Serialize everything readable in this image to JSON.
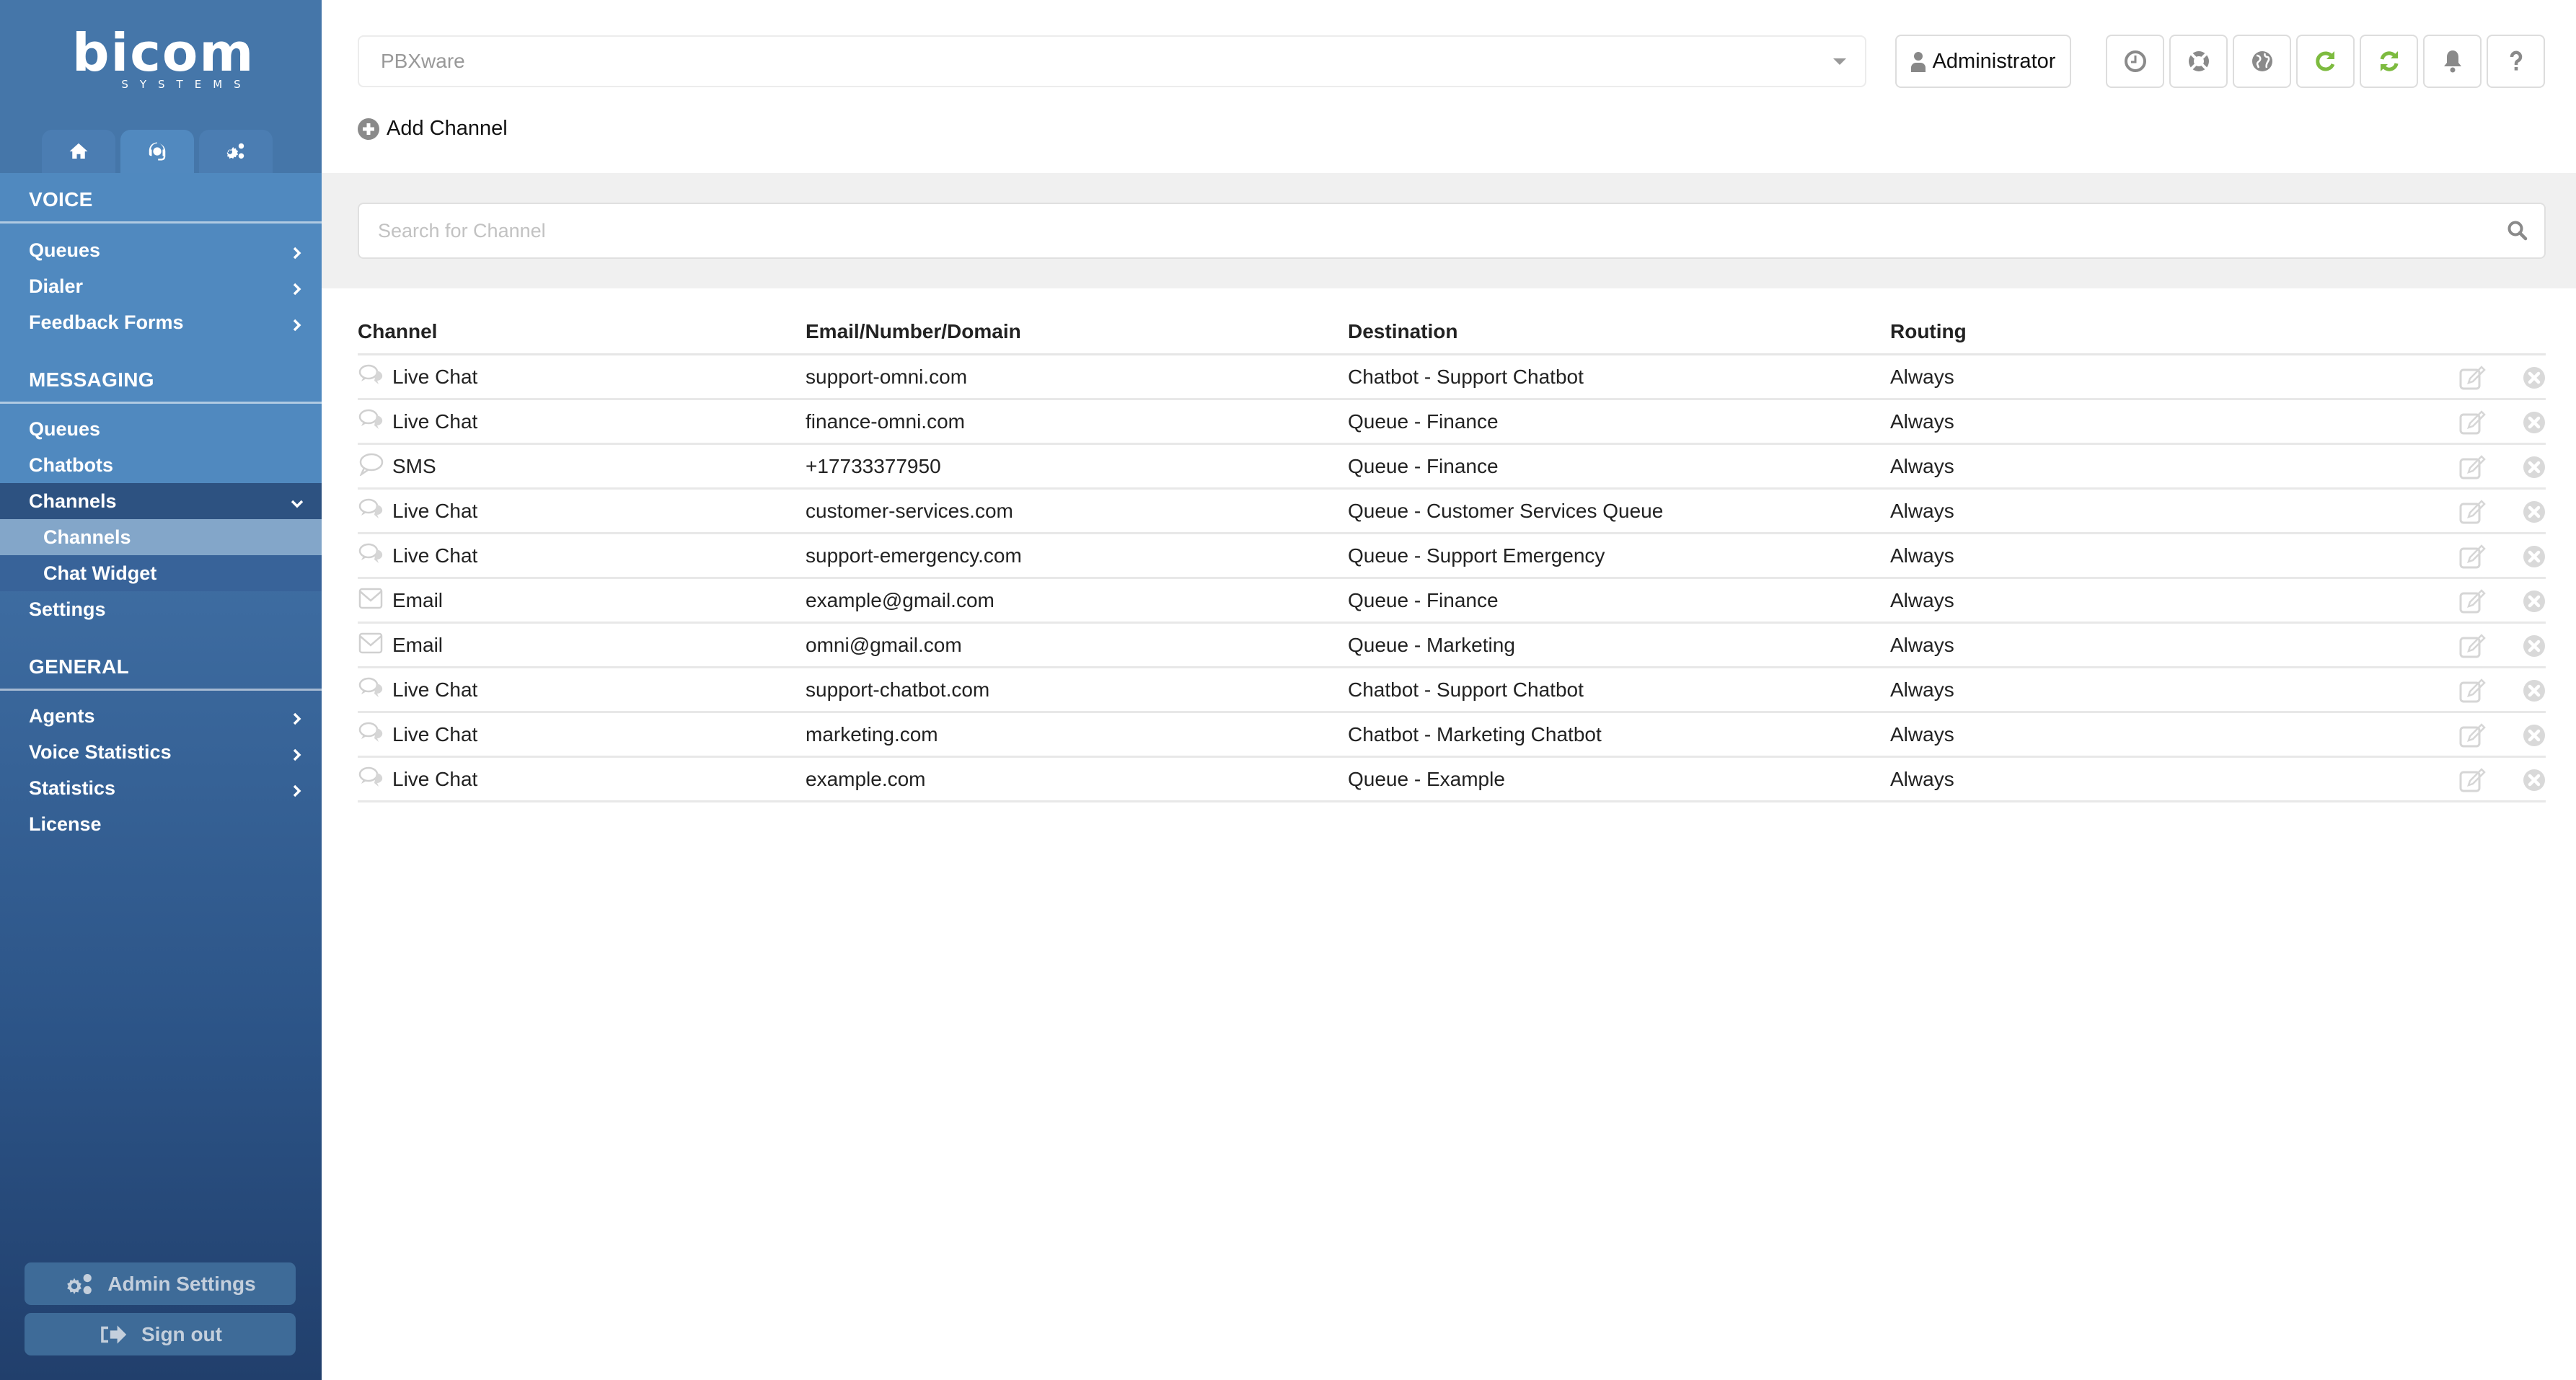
{
  "brand": {
    "name": "bicom",
    "tagline": "SYSTEMS"
  },
  "top_tabs": [
    {
      "name": "home",
      "icon": "home-icon",
      "active": false
    },
    {
      "name": "omni-agent",
      "icon": "headset-icon",
      "active": true
    },
    {
      "name": "settings",
      "icon": "gears-icon",
      "active": false
    }
  ],
  "sidebar": {
    "sections": [
      {
        "title": "VOICE",
        "items": [
          {
            "label": "Queues",
            "chevron": "right"
          },
          {
            "label": "Dialer",
            "chevron": "right"
          },
          {
            "label": "Feedback Forms",
            "chevron": "right"
          }
        ]
      },
      {
        "title": "MESSAGING",
        "items": [
          {
            "label": "Queues"
          },
          {
            "label": "Chatbots"
          },
          {
            "label": "Channels",
            "chevron": "down",
            "open": true,
            "children": [
              {
                "label": "Channels",
                "active": true
              },
              {
                "label": "Chat Widget"
              }
            ]
          },
          {
            "label": "Settings"
          }
        ]
      },
      {
        "title": "GENERAL",
        "items": [
          {
            "label": "Agents",
            "chevron": "right"
          },
          {
            "label": "Voice Statistics",
            "chevron": "right"
          },
          {
            "label": "Statistics",
            "chevron": "right"
          },
          {
            "label": "License"
          }
        ]
      }
    ],
    "admin_settings_label": "Admin Settings",
    "sign_out_label": "Sign out"
  },
  "header": {
    "server_select": {
      "value": "PBXware"
    },
    "user_button": "Administrator",
    "icon_buttons": [
      {
        "icon": "clock-icon",
        "color": "#8a8a8a"
      },
      {
        "icon": "lifebuoy-icon",
        "color": "#8a8a8a"
      },
      {
        "icon": "globe-icon",
        "color": "#8a8a8a"
      },
      {
        "icon": "reload-icon",
        "color": "#7dbb3f"
      },
      {
        "icon": "sync-icon",
        "color": "#7dbb3f"
      },
      {
        "icon": "bell-icon",
        "color": "#8a8a8a"
      },
      {
        "icon": "help-icon",
        "color": "#8a8a8a"
      }
    ]
  },
  "actions": {
    "add_channel_label": "Add Channel"
  },
  "search": {
    "placeholder": "Search for Channel",
    "value": ""
  },
  "table": {
    "columns": [
      "Channel",
      "Email/Number/Domain",
      "Destination",
      "Routing"
    ],
    "rows": [
      {
        "type": "livechat",
        "channel": "Live Chat",
        "address": "support-omni.com",
        "destination": "Chatbot - Support Chatbot",
        "routing": "Always"
      },
      {
        "type": "livechat",
        "channel": "Live Chat",
        "address": "finance-omni.com",
        "destination": "Queue - Finance",
        "routing": "Always"
      },
      {
        "type": "sms",
        "channel": "SMS",
        "address": "+17733377950",
        "destination": "Queue - Finance",
        "routing": "Always"
      },
      {
        "type": "livechat",
        "channel": "Live Chat",
        "address": "customer-services.com",
        "destination": "Queue - Customer Services Queue",
        "routing": "Always"
      },
      {
        "type": "livechat",
        "channel": "Live Chat",
        "address": "support-emergency.com",
        "destination": "Queue - Support Emergency",
        "routing": "Always"
      },
      {
        "type": "email",
        "channel": "Email",
        "address": "example@gmail.com",
        "destination": "Queue - Finance",
        "routing": "Always"
      },
      {
        "type": "email",
        "channel": "Email",
        "address": "omni@gmail.com",
        "destination": "Queue - Marketing",
        "routing": "Always"
      },
      {
        "type": "livechat",
        "channel": "Live Chat",
        "address": "support-chatbot.com",
        "destination": "Chatbot - Support Chatbot",
        "routing": "Always"
      },
      {
        "type": "livechat",
        "channel": "Live Chat",
        "address": "marketing.com",
        "destination": "Chatbot - Marketing Chatbot",
        "routing": "Always"
      },
      {
        "type": "livechat",
        "channel": "Live Chat",
        "address": "example.com",
        "destination": "Queue - Example",
        "routing": "Always"
      }
    ]
  },
  "colors": {
    "sidebar_top": "#4a80b9",
    "sidebar_bottom": "#213f6c",
    "accent_green": "#7dbb3f",
    "icon_gray": "#8a8a8a"
  }
}
